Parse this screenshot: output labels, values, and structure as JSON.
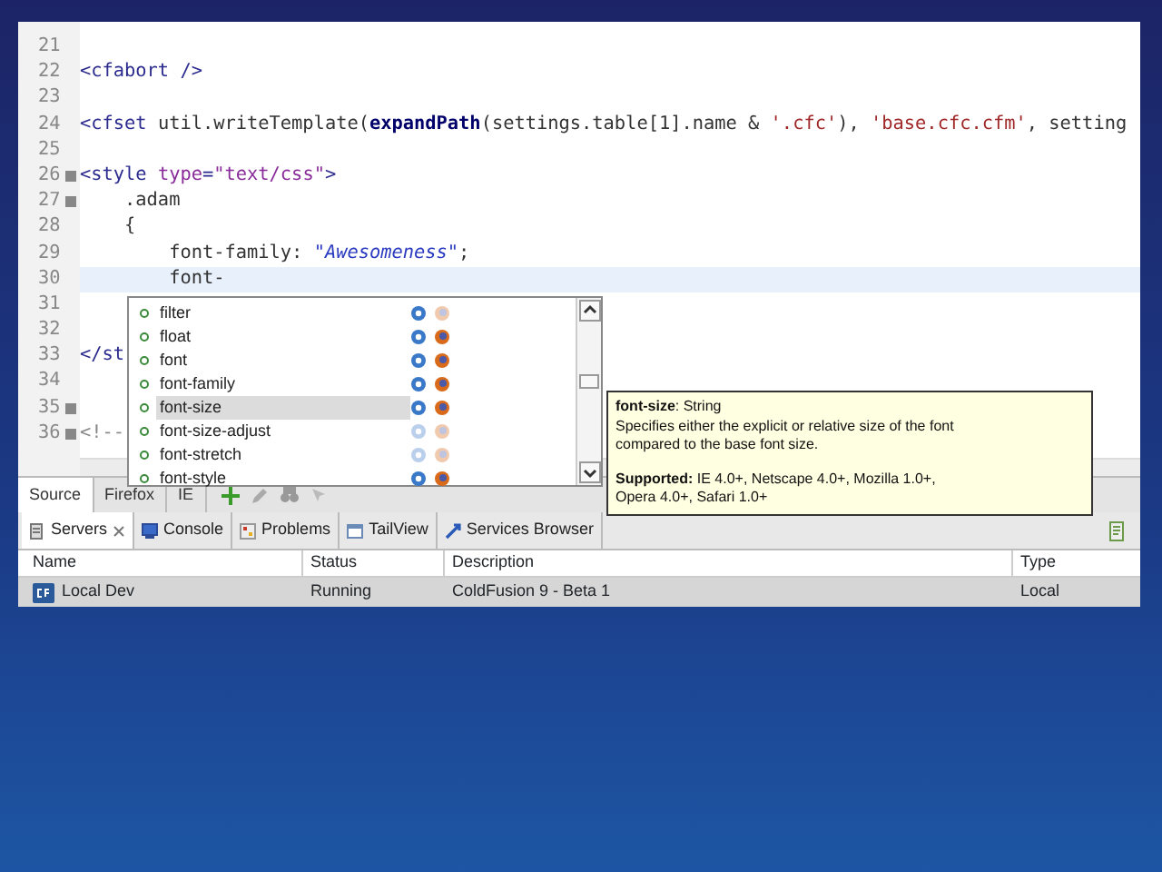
{
  "editor": {
    "lines": [
      {
        "number": "21",
        "fold": false,
        "current": false
      },
      {
        "number": "22",
        "fold": false,
        "current": false,
        "tokens": [
          {
            "kind": "tag",
            "text": "<cfabort />"
          }
        ]
      },
      {
        "number": "23",
        "fold": false,
        "current": false
      },
      {
        "number": "24",
        "fold": false,
        "current": false,
        "tokens": [
          {
            "kind": "tag",
            "text": "<cfset "
          },
          {
            "kind": "plain",
            "text": "util.writeTemplate("
          },
          {
            "kind": "func",
            "text": "expandPath"
          },
          {
            "kind": "plain",
            "text": "(settings.table[1].name & "
          },
          {
            "kind": "string",
            "text": "'.cfc'"
          },
          {
            "kind": "plain",
            "text": "), "
          },
          {
            "kind": "string",
            "text": "'base.cfc.cfm'"
          },
          {
            "kind": "plain",
            "text": ", setting"
          }
        ]
      },
      {
        "number": "25",
        "fold": false,
        "current": false
      },
      {
        "number": "26",
        "fold": true,
        "current": false,
        "tokens": [
          {
            "kind": "tag",
            "text": "<style "
          },
          {
            "kind": "attr",
            "text": "type"
          },
          {
            "kind": "tag",
            "text": "="
          },
          {
            "kind": "attr",
            "text": "\"text/css\""
          },
          {
            "kind": "tag",
            "text": ">"
          }
        ]
      },
      {
        "number": "27",
        "fold": true,
        "current": false,
        "tokens": [
          {
            "kind": "plain",
            "text": "    .adam"
          }
        ]
      },
      {
        "number": "28",
        "fold": false,
        "current": false,
        "tokens": [
          {
            "kind": "plain",
            "text": "    {"
          }
        ]
      },
      {
        "number": "29",
        "fold": false,
        "current": false,
        "tokens": [
          {
            "kind": "prop",
            "text": "        font-family: "
          },
          {
            "kind": "italic",
            "text": "\"Awesomeness\""
          },
          {
            "kind": "plain",
            "text": ";"
          }
        ]
      },
      {
        "number": "30",
        "fold": false,
        "current": true,
        "tokens": [
          {
            "kind": "prop",
            "text": "        font-"
          }
        ]
      },
      {
        "number": "31",
        "fold": false,
        "current": false
      },
      {
        "number": "32",
        "fold": false,
        "current": false
      },
      {
        "number": "33",
        "fold": false,
        "current": false,
        "tokens": [
          {
            "kind": "tag",
            "text": "</st"
          }
        ]
      },
      {
        "number": "34",
        "fold": false,
        "current": false
      },
      {
        "number": "35",
        "fold": true,
        "current": false
      },
      {
        "number": "36",
        "fold": true,
        "current": false,
        "tokens": [
          {
            "kind": "comment",
            "text": "<!--"
          }
        ]
      }
    ]
  },
  "autocomplete": {
    "items": [
      {
        "label": "filter",
        "selected": false,
        "ie": true,
        "firefox": false
      },
      {
        "label": "float",
        "selected": false,
        "ie": true,
        "firefox": true
      },
      {
        "label": "font",
        "selected": false,
        "ie": true,
        "firefox": true
      },
      {
        "label": "font-family",
        "selected": false,
        "ie": true,
        "firefox": true
      },
      {
        "label": "font-size",
        "selected": true,
        "ie": true,
        "firefox": true
      },
      {
        "label": "font-size-adjust",
        "selected": false,
        "ie": false,
        "firefox": false
      },
      {
        "label": "font-stretch",
        "selected": false,
        "ie": false,
        "firefox": false
      },
      {
        "label": "font-style",
        "selected": false,
        "ie": true,
        "firefox": true
      }
    ]
  },
  "tooltip": {
    "heading": "**font-size**: String",
    "description": "Specifies either the explicit or relative size of the font compared to the base font size.",
    "support": "**Supported:** IE 4.0+, Netscape 4.0+, Mozilla 1.0+, Opera 4.0+, Safari 1.0+"
  },
  "editor_tabs": [
    {
      "label": "Source",
      "selected": true
    },
    {
      "label": "Firefox",
      "selected": false
    },
    {
      "label": "IE",
      "selected": false
    }
  ],
  "panel_tabs": [
    {
      "label": "Servers",
      "selected": true
    },
    {
      "label": "Console",
      "selected": false
    },
    {
      "label": "Problems",
      "selected": false
    },
    {
      "label": "TailView",
      "selected": false
    },
    {
      "label": "Services Browser",
      "selected": false
    }
  ],
  "servers_table": {
    "columns": [
      "Name",
      "Status",
      "Description",
      "Type"
    ],
    "rows": [
      {
        "cells": [
          "Local Dev",
          "Running",
          "ColdFusion 9 - Beta 1",
          "Local"
        ]
      }
    ]
  }
}
